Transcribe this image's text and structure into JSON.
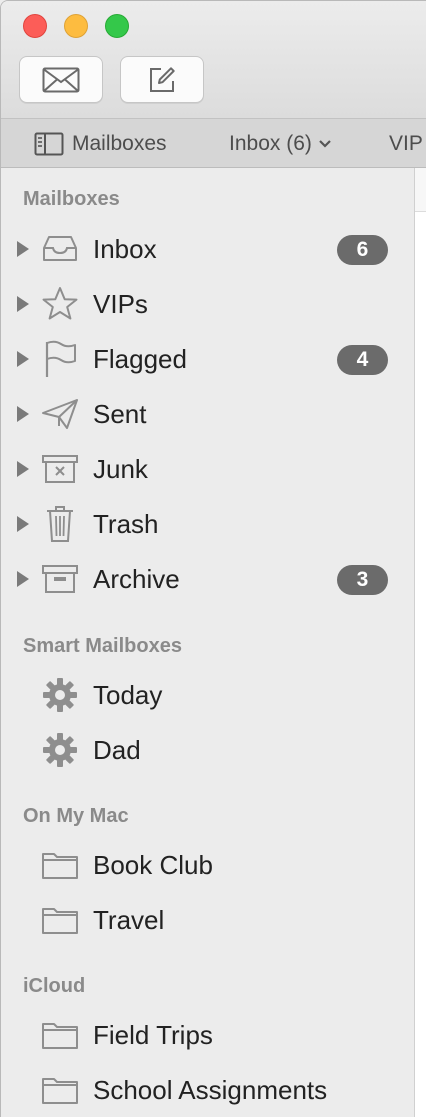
{
  "window": {
    "traffic_lights": {
      "close": "#fc5d58",
      "minimize": "#fdbc40",
      "zoom": "#34c84a"
    }
  },
  "toolbar": {
    "get_mail_icon": "envelope-icon",
    "compose_icon": "compose-icon"
  },
  "favorites_bar": {
    "mailboxes_label": "Mailboxes",
    "inbox_label": "Inbox (6)",
    "vip_label": "VIP"
  },
  "sidebar": {
    "sections": {
      "mailboxes": {
        "header": "Mailboxes",
        "items": [
          {
            "label": "Inbox",
            "icon": "inbox-tray-icon",
            "badge": "6"
          },
          {
            "label": "VIPs",
            "icon": "star-icon",
            "badge": ""
          },
          {
            "label": "Flagged",
            "icon": "flag-icon",
            "badge": "4"
          },
          {
            "label": "Sent",
            "icon": "paper-plane-icon",
            "badge": ""
          },
          {
            "label": "Junk",
            "icon": "junk-box-icon",
            "badge": ""
          },
          {
            "label": "Trash",
            "icon": "trash-can-icon",
            "badge": ""
          },
          {
            "label": "Archive",
            "icon": "archive-box-icon",
            "badge": "3"
          }
        ]
      },
      "smart": {
        "header": "Smart Mailboxes",
        "items": [
          {
            "label": "Today",
            "icon": "gear-icon"
          },
          {
            "label": "Dad",
            "icon": "gear-icon"
          }
        ]
      },
      "on_my_mac": {
        "header": "On My Mac",
        "items": [
          {
            "label": "Book Club",
            "icon": "folder-icon"
          },
          {
            "label": "Travel",
            "icon": "folder-icon"
          }
        ]
      },
      "icloud": {
        "header": "iCloud",
        "items": [
          {
            "label": "Field Trips",
            "icon": "folder-icon"
          },
          {
            "label": "School Assignments",
            "icon": "folder-icon"
          }
        ]
      }
    }
  },
  "colors": {
    "badge_bg": "#6b6b6b",
    "icon_gray": "#8e8e8e",
    "sidebar_bg": "#ececec"
  }
}
